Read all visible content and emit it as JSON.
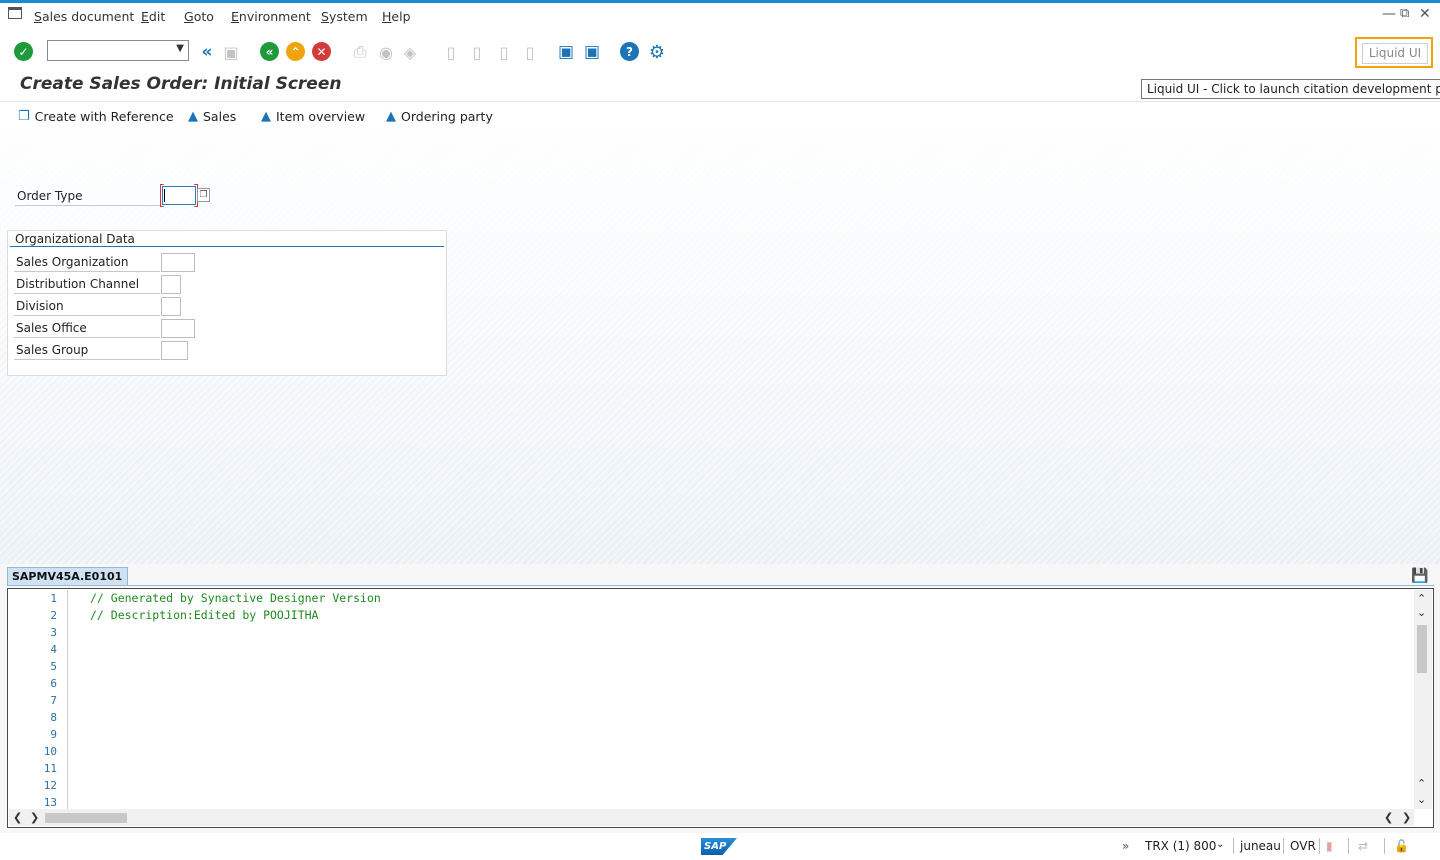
{
  "menubar": {
    "items": [
      "Sales document",
      "Edit",
      "Goto",
      "Environment",
      "System",
      "Help"
    ]
  },
  "toolbar": {
    "command_field_value": "",
    "liquid_ui_label": "Liquid UI",
    "tooltip": "Liquid UI - Click to launch citation development panel",
    "icons": [
      "enter-icon",
      "back-nav-icon",
      "save-icon",
      "back-icon",
      "exit-icon",
      "cancel-icon",
      "print-icon",
      "find-icon",
      "find-next-icon",
      "first-page-icon",
      "previous-page-icon",
      "next-page-icon",
      "last-page-icon",
      "create-session-icon",
      "shortcut-icon",
      "help-icon",
      "customize-layout-icon"
    ]
  },
  "page": {
    "title": "Create Sales Order: Initial Screen"
  },
  "app_toolbar": {
    "buttons": [
      "Create with Reference",
      "Sales",
      "Item overview",
      "Ordering party"
    ]
  },
  "form": {
    "order_type_label": "Order Type",
    "order_type_value": "",
    "org_data": {
      "title": "Organizational Data",
      "fields": [
        {
          "label": "Sales Organization",
          "value": ""
        },
        {
          "label": "Distribution Channel",
          "value": ""
        },
        {
          "label": "Division",
          "value": ""
        },
        {
          "label": "Sales Office",
          "value": ""
        },
        {
          "label": "Sales Group",
          "value": ""
        }
      ]
    }
  },
  "editor": {
    "tab_label": "SAPMV45A.E0101",
    "line_numbers": [
      "1",
      "2",
      "3",
      "4",
      "5",
      "6",
      "7",
      "8",
      "9",
      "10",
      "11",
      "12",
      "13"
    ],
    "lines": [
      "// Generated by Synactive Designer Version",
      "// Description:Edited by POOJITHA"
    ]
  },
  "statusbar": {
    "logo": "SAP",
    "system": "TRX (1) 800",
    "user": "juneau",
    "mode": "OVR"
  }
}
